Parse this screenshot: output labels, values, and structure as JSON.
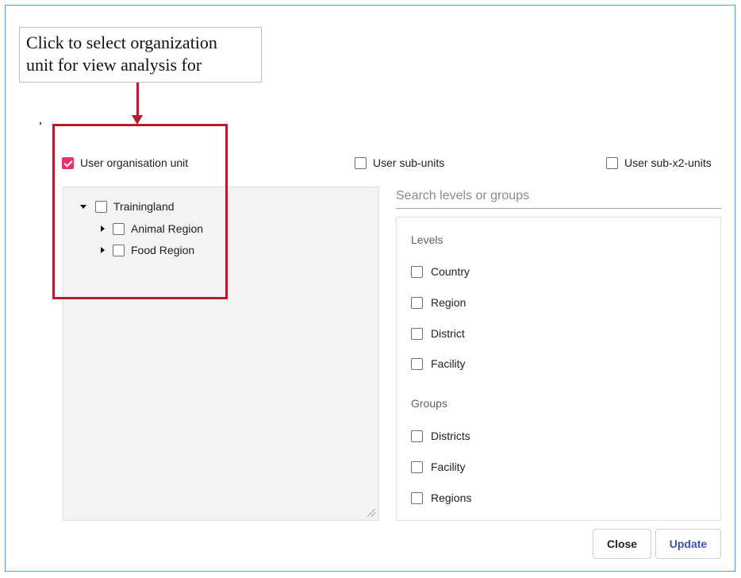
{
  "callout": {
    "line1": "Click to select organization",
    "line2": "unit for view analysis for"
  },
  "colors": {
    "annotation": "#b01e2f",
    "checkbox_checked": "#e8306a",
    "update_text": "#3f51b5",
    "frame_border": "#5b9bd5"
  },
  "top_options": [
    {
      "label": "User organisation unit",
      "checked": true,
      "icon": "checkbox-checked"
    },
    {
      "label": "User sub-units",
      "checked": false,
      "icon": "checkbox-empty"
    },
    {
      "label": "User sub-x2-units",
      "checked": false,
      "icon": "checkbox-empty"
    }
  ],
  "tree": [
    {
      "label": "Trainingland",
      "expanded": true,
      "icon": "caret-down-icon"
    },
    {
      "label": "Animal Region",
      "expanded": false,
      "icon": "caret-right-icon"
    },
    {
      "label": "Food Region",
      "expanded": false,
      "icon": "caret-right-icon"
    }
  ],
  "search": {
    "placeholder": "Search levels or groups",
    "value": ""
  },
  "levels": {
    "title": "Levels",
    "items": [
      "Country",
      "Region",
      "District",
      "Facility"
    ]
  },
  "groups": {
    "title": "Groups",
    "items": [
      "Districts",
      "Facility",
      "Regions"
    ]
  },
  "buttons": {
    "close": "Close",
    "update": "Update"
  }
}
